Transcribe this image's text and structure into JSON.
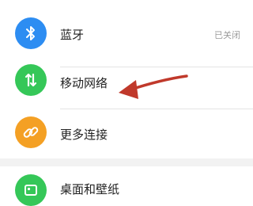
{
  "colors": {
    "bluetooth_icon": "#2d8df2",
    "mobile_network_icon": "#35c758",
    "more_connections_icon": "#f4a024",
    "wallpaper_icon": "#35c758",
    "annotation_arrow": "#c0392b"
  },
  "settings": {
    "items": [
      {
        "label": "蓝牙",
        "status": "已关闭",
        "icon": "bluetooth-icon"
      },
      {
        "label": "移动网络",
        "icon": "mobile-data-arrows-icon"
      },
      {
        "label": "更多连接",
        "icon": "link-icon"
      },
      {
        "label": "桌面和壁纸",
        "icon": "image-icon"
      }
    ]
  },
  "annotation": {
    "icon": "red-arrow-pointing-left"
  }
}
